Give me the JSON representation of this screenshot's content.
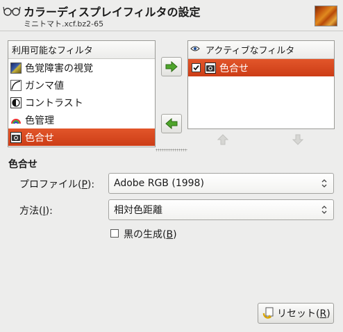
{
  "header": {
    "title": "カラーディスプレイフィルタの設定",
    "subtitle": "ミニトマト.xcf.bz2-65"
  },
  "available": {
    "header": "利用可能なフィルタ",
    "items": [
      {
        "label": "色覚障害の視覚",
        "icon": "color-deficient-icon"
      },
      {
        "label": "ガンマ値",
        "icon": "gamma-curve-icon"
      },
      {
        "label": "コントラスト",
        "icon": "contrast-icon"
      },
      {
        "label": "色管理",
        "icon": "color-management-icon"
      },
      {
        "label": "色合せ",
        "icon": "proof-icon",
        "selected": true
      }
    ]
  },
  "active": {
    "header": "アクティブなフィルタ",
    "items": [
      {
        "label": "色合せ",
        "checked": true,
        "selected": true
      }
    ]
  },
  "settings": {
    "section_title": "色合せ",
    "profile_label_pre": "プロファイル(",
    "profile_mnemonic": "P",
    "profile_label_post": "):",
    "profile_value": "Adobe RGB (1998)",
    "method_label_pre": "方法(",
    "method_mnemonic": "I",
    "method_label_post": "):",
    "method_value": "相対色距離",
    "blackpoint_pre": "黒の生成(",
    "blackpoint_mnemonic": "B",
    "blackpoint_post": ")",
    "blackpoint_checked": false
  },
  "reset": {
    "label_pre": "リセット(",
    "mnemonic": "R",
    "label_post": ")"
  },
  "colors": {
    "selection": "#d8461c",
    "arrow_green": "#3a8a1c"
  }
}
